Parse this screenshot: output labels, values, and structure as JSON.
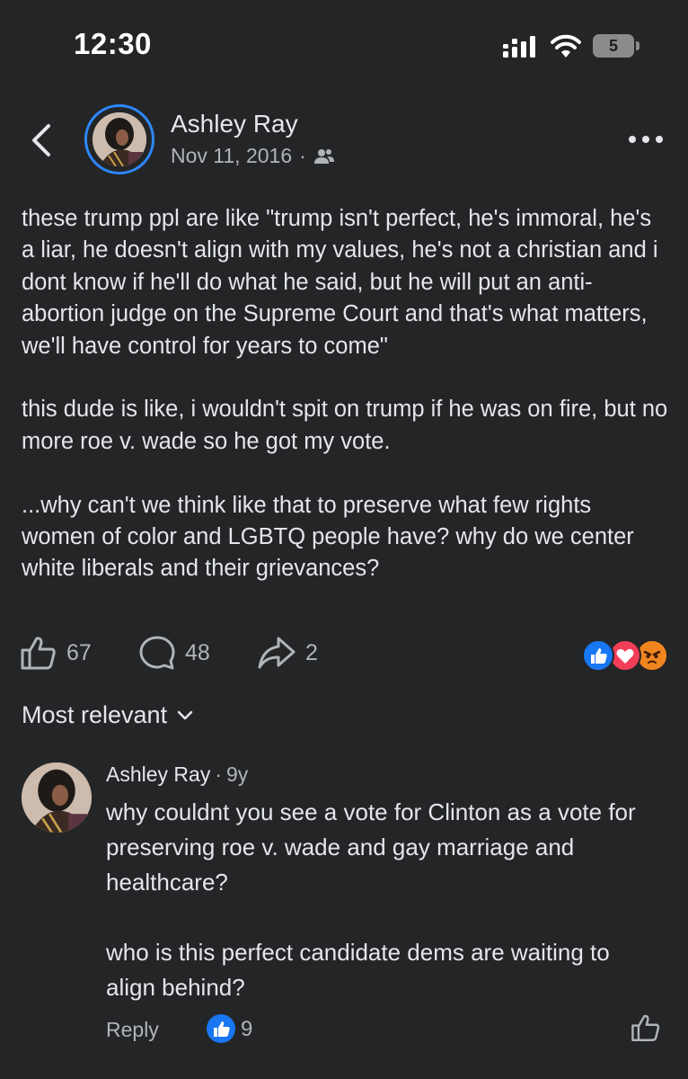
{
  "status_bar": {
    "time": "12:30",
    "battery": "5"
  },
  "post": {
    "author": "Ashley Ray",
    "date": "Nov 11, 2016",
    "separator": "·",
    "audience_icon": "friends-icon",
    "paragraphs": [
      "these trump ppl are like \"trump isn't perfect, he's immoral, he's a liar, he doesn't align with my values, he's not a christian and i dont know if he'll do what he said, but he will put an anti-abortion judge on the Supreme Court and that's what matters, we'll have control for years to come\"",
      "this dude is like, i wouldn't spit on trump if he was on fire, but no more roe v. wade so he got my vote.",
      "...why can't we think like that to preserve what few rights women of color and LGBTQ people have? why do we center white liberals and their grievances?"
    ],
    "likes": "67",
    "comments": "48",
    "shares": "2",
    "reactions": [
      "like",
      "love",
      "angry"
    ]
  },
  "comments_section": {
    "sort_label": "Most relevant"
  },
  "comment": {
    "author": "Ashley Ray",
    "separator": "·",
    "time": "9y",
    "paragraphs": [
      "why couldnt you see a vote for Clinton as a vote for preserving roe v. wade and gay marriage and healthcare?",
      "who is this perfect candidate dems are waiting to align behind?"
    ],
    "reply_label": "Reply",
    "like_count": "9"
  },
  "colors": {
    "background": "#242526",
    "text": "#e4e6eb",
    "muted": "#b0b3b8",
    "accent": "#2d88ff",
    "love": "#f33e58",
    "angry": "#e9710f"
  }
}
